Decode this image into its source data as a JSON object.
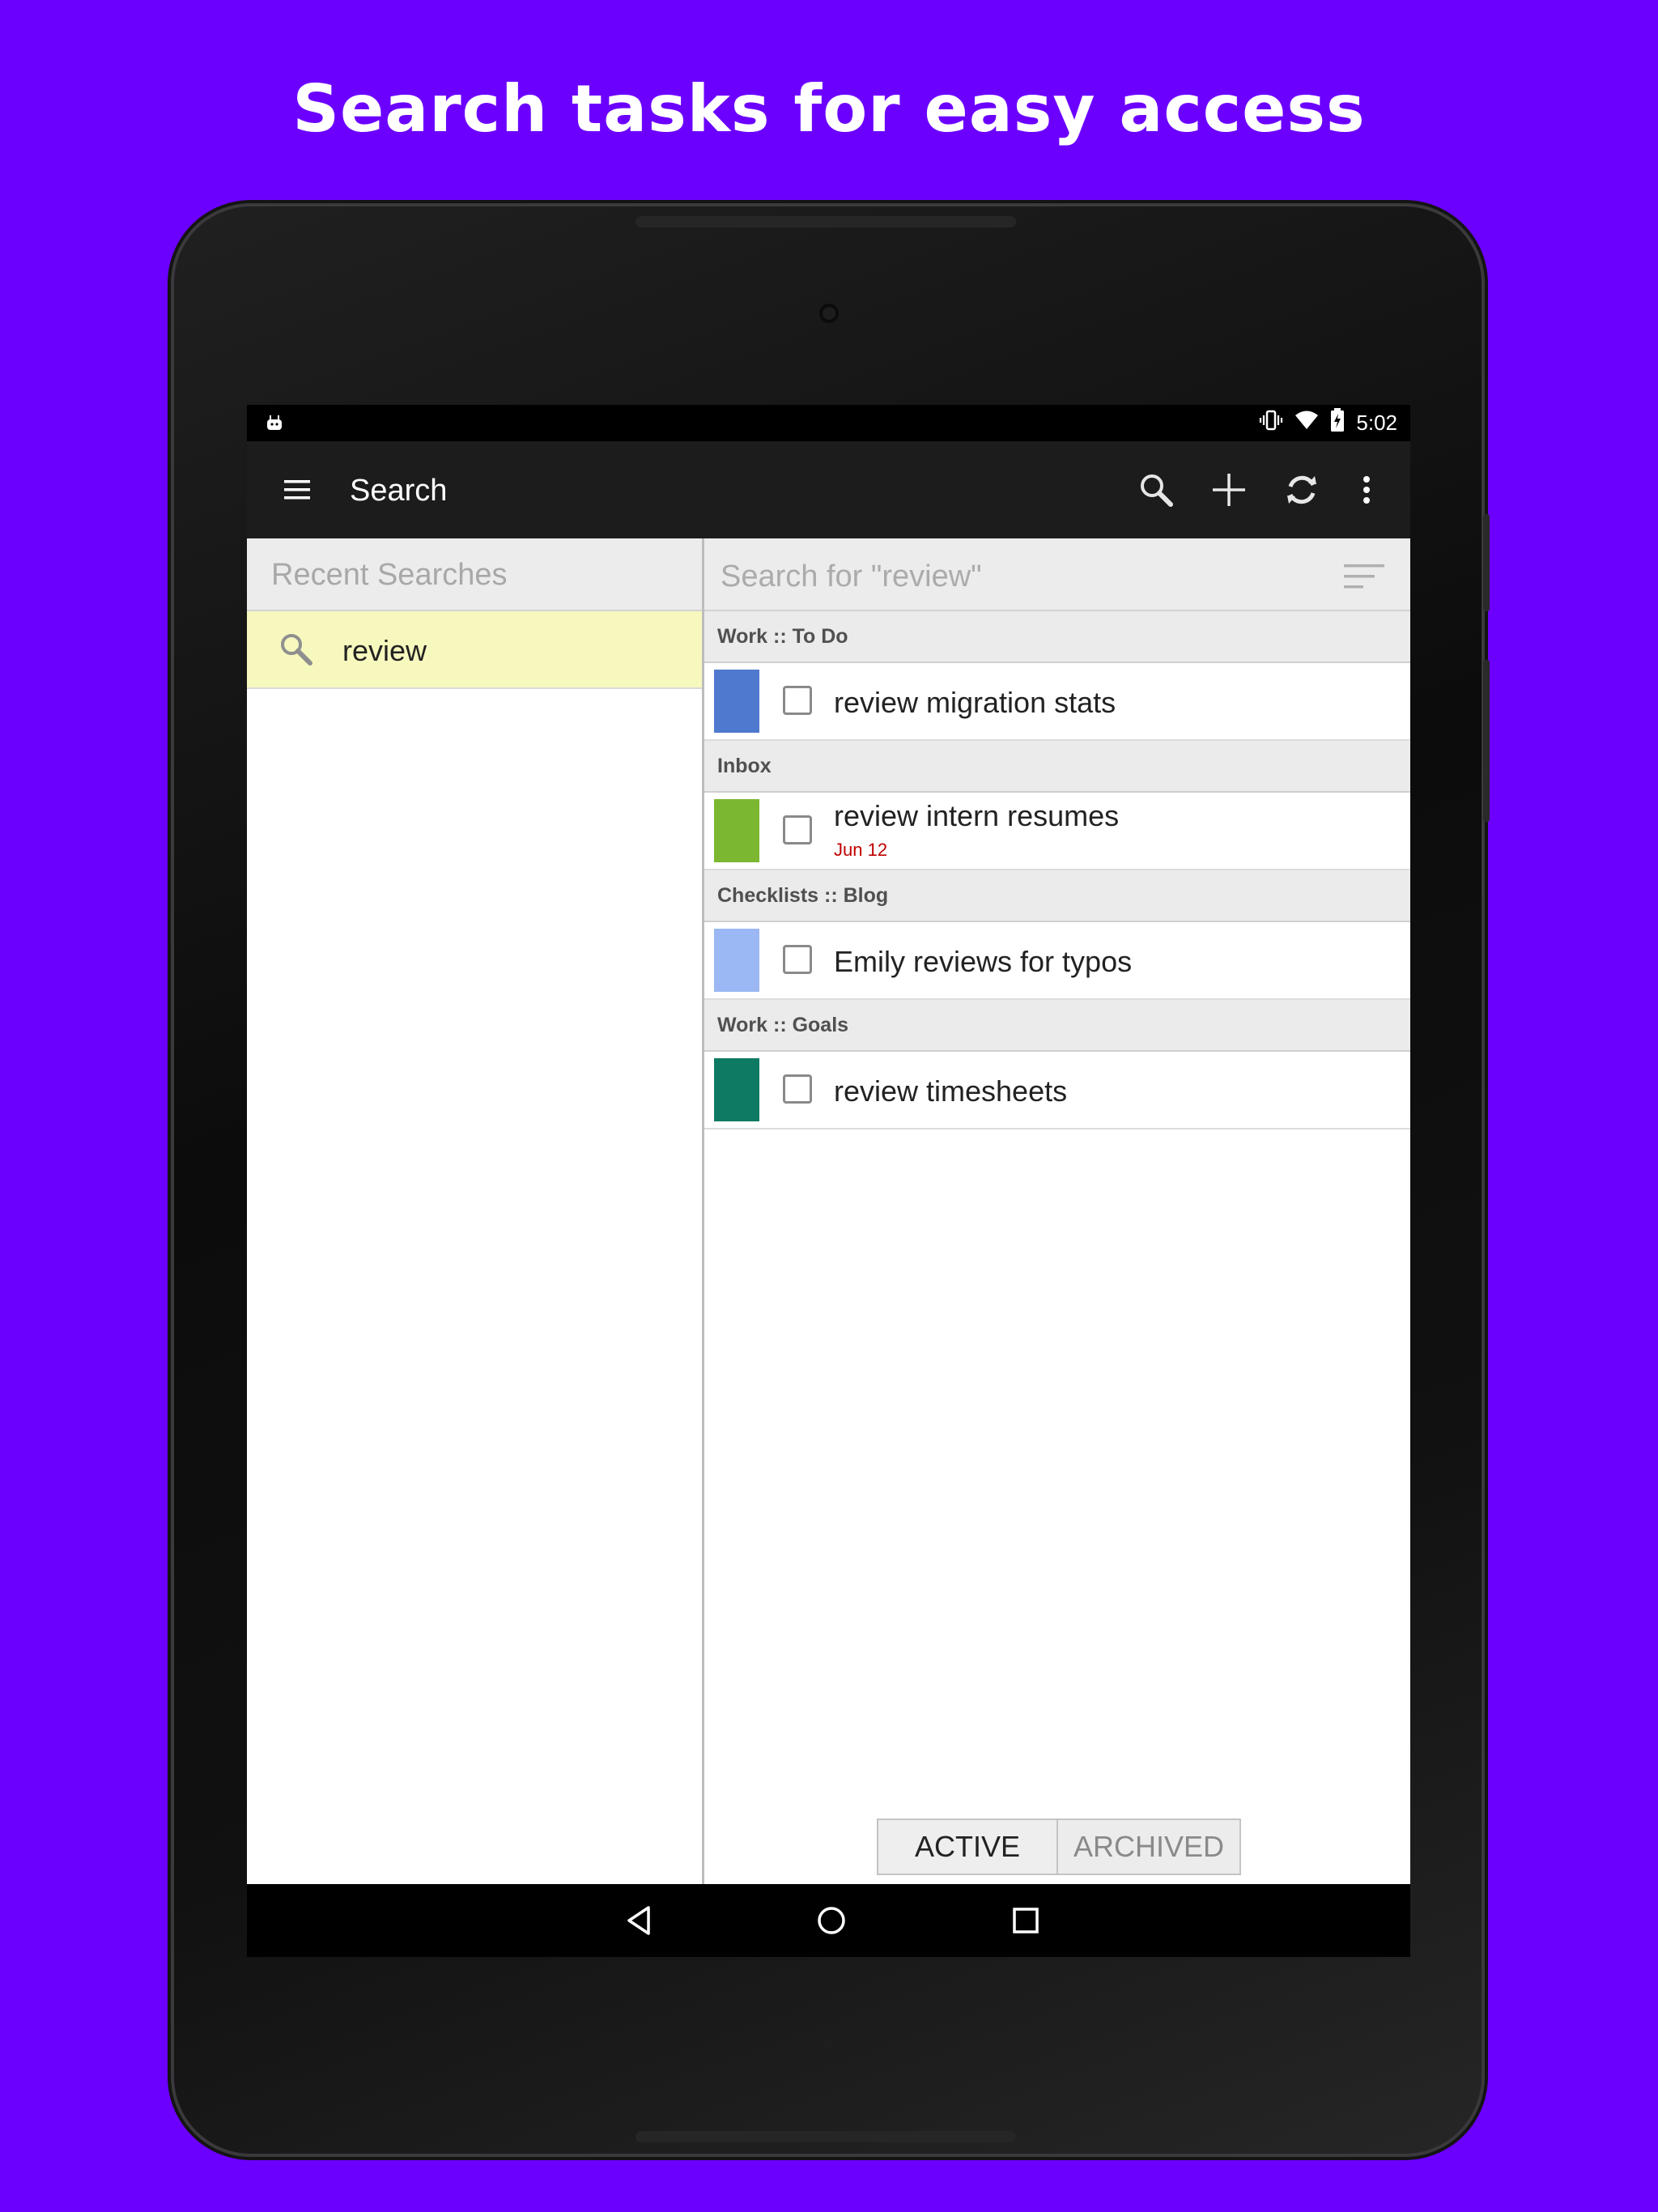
{
  "headline": "Search tasks for easy access",
  "status_bar": {
    "time": "5:02"
  },
  "app_bar": {
    "title": "Search"
  },
  "recent": {
    "header": "Recent Searches",
    "items": [
      {
        "label": "review"
      }
    ]
  },
  "results": {
    "placeholder": "Search for \"review\"",
    "groups": [
      {
        "name": "Work :: To Do",
        "task": {
          "title": "review migration stats",
          "date": "",
          "color": "#4f78cf"
        }
      },
      {
        "name": "Inbox",
        "task": {
          "title": "review intern resumes",
          "date": "Jun 12",
          "color": "#7bb730"
        }
      },
      {
        "name": "Checklists :: Blog",
        "task": {
          "title": "Emily reviews for typos",
          "date": "",
          "color": "#9bb7f4"
        }
      },
      {
        "name": "Work :: Goals",
        "task": {
          "title": "review timesheets",
          "date": "",
          "color": "#0f7a63"
        }
      }
    ]
  },
  "toggle": {
    "active_label": "ACTIVE",
    "archived_label": "ARCHIVED"
  },
  "icons": [
    "menu-icon",
    "search-icon",
    "add-icon",
    "sync-icon",
    "more-vert-icon",
    "sort-icon",
    "back-icon",
    "home-icon",
    "recents-icon"
  ]
}
